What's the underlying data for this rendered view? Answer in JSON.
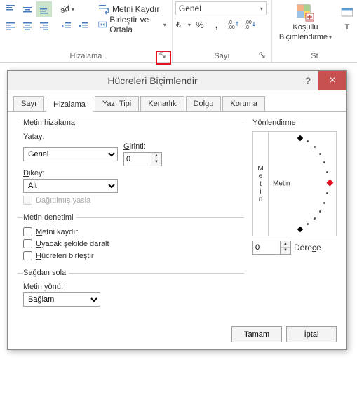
{
  "ribbon": {
    "alignment_group": "Hizalama",
    "number_group": "Sayı",
    "styles_group": "St",
    "wrap_text": "Metni Kaydır",
    "merge_center": "Birleştir ve Ortala",
    "number_format_value": "Genel",
    "conditional_formatting_line1": "Koşullu",
    "conditional_formatting_line2": "Biçimlendirme",
    "t_label": "T"
  },
  "dialog": {
    "title": "Hücreleri Biçimlendir",
    "help": "?",
    "close": "×",
    "tabs": {
      "number": "Sayı",
      "alignment": "Hizalama",
      "font": "Yazı Tipi",
      "border": "Kenarlık",
      "fill": "Dolgu",
      "protection": "Koruma"
    },
    "text_alignment": {
      "legend": "Metin hizalama",
      "horizontal_label": "Yatay:",
      "horizontal_value": "Genel",
      "indent_label": "Girinti:",
      "indent_value": "0",
      "vertical_label": "Dikey:",
      "vertical_value": "Alt",
      "justify_distributed": "Dağıtılmış yasla"
    },
    "text_control": {
      "legend": "Metin denetimi",
      "wrap": "Metni kaydır",
      "shrink": "Uyacak şekilde daralt",
      "merge": "Hücreleri birleştir"
    },
    "rtl": {
      "legend": "Sağdan sola",
      "direction_label": "Metin yönü:",
      "direction_value": "Bağlam"
    },
    "orientation": {
      "legend": "Yönlendirme",
      "vertical_text": "Metin",
      "main_text": "Metin",
      "degree_value": "0",
      "degree_label": "Derece"
    },
    "ok": "Tamam",
    "cancel": "İptal"
  }
}
